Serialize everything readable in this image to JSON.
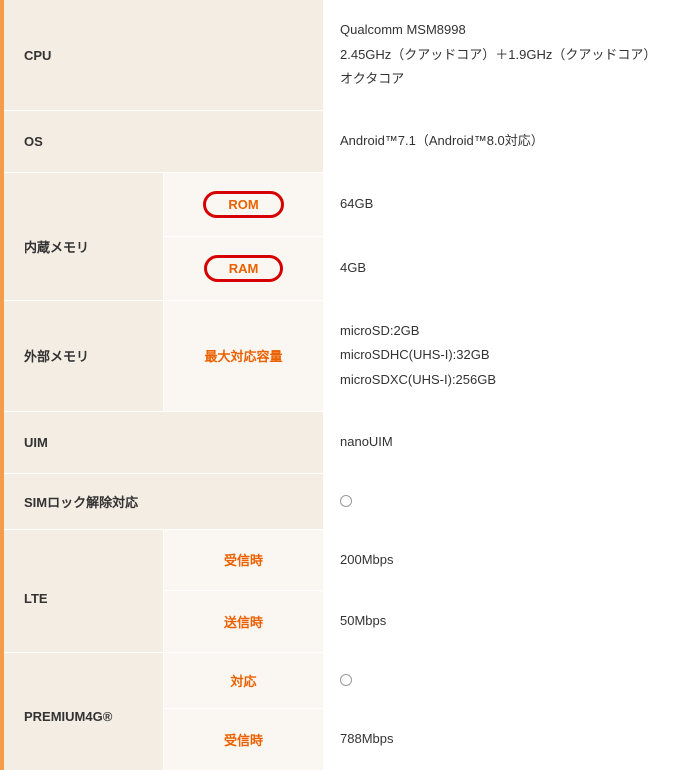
{
  "rows": {
    "cpu": {
      "label": "CPU",
      "value": "Qualcomm MSM8998\n2.45GHz（クアッドコア）＋1.9GHz（クアッドコア）\nオクタコア"
    },
    "os": {
      "label": "OS",
      "value": "Android™7.1（Android™8.0対応）"
    },
    "internal_memory": {
      "label": "内蔵メモリ",
      "rom_label": "ROM",
      "rom_value": "64GB",
      "ram_label": "RAM",
      "ram_value": "4GB"
    },
    "external_memory": {
      "label": "外部メモリ",
      "sub_label": "最大対応容量",
      "value": "microSD:2GB\nmicroSDHC(UHS-I):32GB\nmicroSDXC(UHS-I):256GB"
    },
    "uim": {
      "label": "UIM",
      "value": "nanoUIM"
    },
    "sim_unlock": {
      "label": "SIMロック解除対応",
      "supported": true
    },
    "lte": {
      "label": "LTE",
      "rx_label": "受信時",
      "rx_value": "200Mbps",
      "tx_label": "送信時",
      "tx_value": "50Mbps"
    },
    "premium4g": {
      "label": "PREMIUM4G®",
      "support_label": "対応",
      "supported": true,
      "rx_label": "受信時",
      "rx_value": "788Mbps"
    }
  }
}
